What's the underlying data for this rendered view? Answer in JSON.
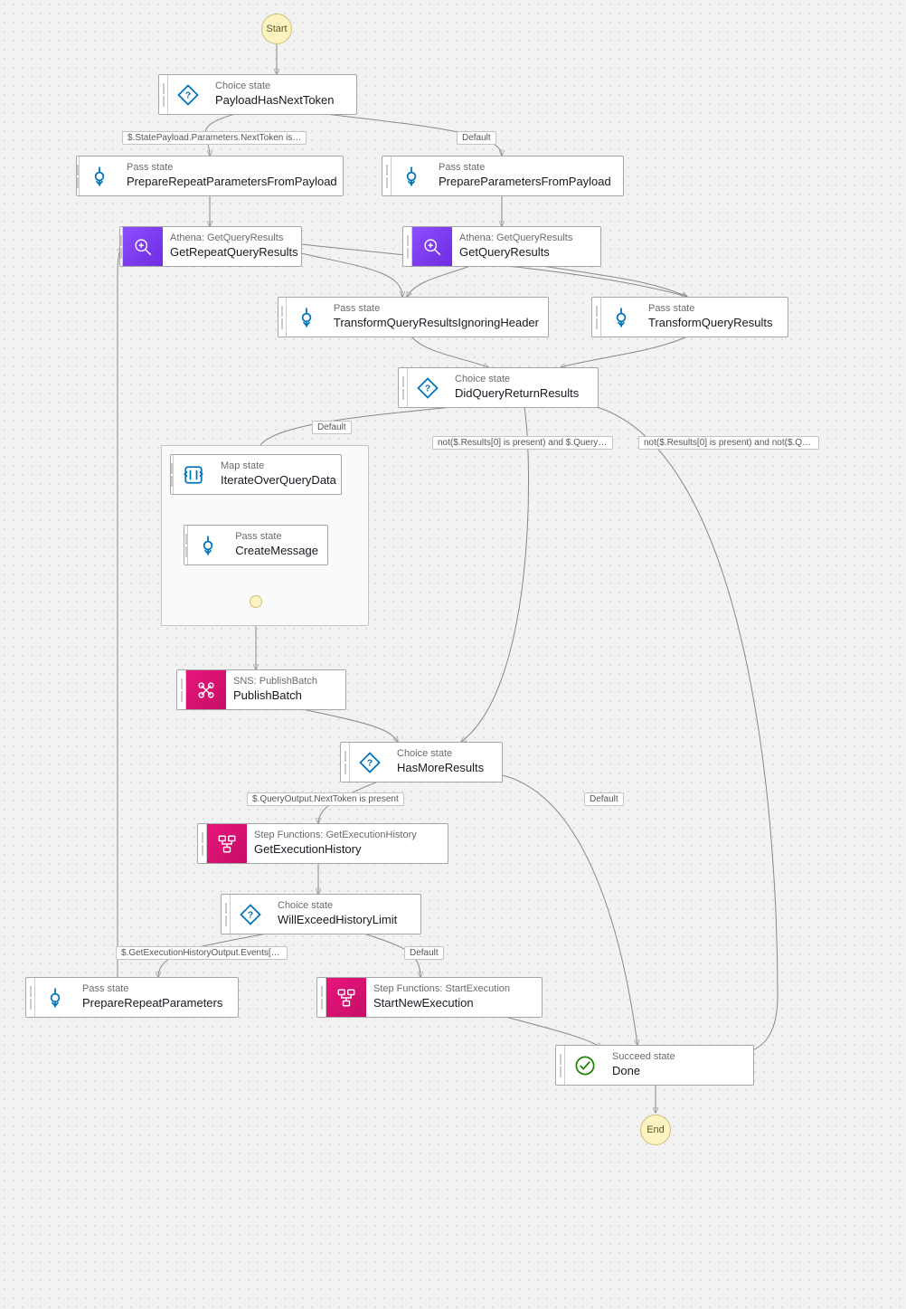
{
  "terminals": {
    "start": "Start",
    "end": "End"
  },
  "edge_labels": {
    "nextTokenPresent": "$.StatePayload.Parameters.NextToken is…",
    "default": "Default",
    "notPresentAndQO": "not($.Results[0] is present) and $.QueryO…",
    "notPresentAndNotQ": "not($.Results[0] is present) and not($.Qu…",
    "queryNextToken": "$.QueryOutput.NextToken is present",
    "historyEvents": "$.GetExecutionHistoryOutput.Events[0]…."
  },
  "nodes": {
    "payloadHasNextToken": {
      "type": "Choice state",
      "name": "PayloadHasNextToken"
    },
    "prepareRepeatFromPayload": {
      "type": "Pass state",
      "name": "PrepareRepeatParametersFromPayload"
    },
    "prepareFromPayload": {
      "type": "Pass state",
      "name": "PrepareParametersFromPayload"
    },
    "getRepeatQueryResults": {
      "type": "Athena: GetQueryResults",
      "name": "GetRepeatQueryResults"
    },
    "getQueryResults": {
      "type": "Athena: GetQueryResults",
      "name": "GetQueryResults"
    },
    "transformIgnoringHeader": {
      "type": "Pass state",
      "name": "TransformQueryResultsIgnoringHeader"
    },
    "transformQueryResults": {
      "type": "Pass state",
      "name": "TransformQueryResults"
    },
    "didQueryReturnResults": {
      "type": "Choice state",
      "name": "DidQueryReturnResults"
    },
    "iterateOverQueryData": {
      "type": "Map state",
      "name": "IterateOverQueryData"
    },
    "createMessage": {
      "type": "Pass state",
      "name": "CreateMessage"
    },
    "publishBatch": {
      "type": "SNS: PublishBatch",
      "name": "PublishBatch"
    },
    "hasMoreResults": {
      "type": "Choice state",
      "name": "HasMoreResults"
    },
    "getExecutionHistory": {
      "type": "Step Functions: GetExecutionHistory",
      "name": "GetExecutionHistory"
    },
    "willExceedHistoryLimit": {
      "type": "Choice state",
      "name": "WillExceedHistoryLimit"
    },
    "prepareRepeatParameters": {
      "type": "Pass state",
      "name": "PrepareRepeatParameters"
    },
    "startNewExecution": {
      "type": "Step Functions: StartExecution",
      "name": "StartNewExecution"
    },
    "done": {
      "type": "Succeed state",
      "name": "Done"
    }
  },
  "chart_data": {
    "type": "state-machine-graph",
    "title": "Step Functions workflow",
    "start": "PayloadHasNextToken",
    "states": [
      {
        "name": "PayloadHasNextToken",
        "kind": "Choice",
        "choices": [
          {
            "cond": "$.StatePayload.Parameters.NextToken is present",
            "next": "PrepareRepeatParametersFromPayload"
          }
        ],
        "default": "PrepareParametersFromPayload"
      },
      {
        "name": "PrepareRepeatParametersFromPayload",
        "kind": "Pass",
        "next": "GetRepeatQueryResults"
      },
      {
        "name": "PrepareParametersFromPayload",
        "kind": "Pass",
        "next": "GetQueryResults"
      },
      {
        "name": "GetRepeatQueryResults",
        "kind": "Task",
        "service": "Athena",
        "api": "GetQueryResults",
        "next": [
          "TransformQueryResultsIgnoringHeader",
          "TransformQueryResults"
        ]
      },
      {
        "name": "GetQueryResults",
        "kind": "Task",
        "service": "Athena",
        "api": "GetQueryResults",
        "next": [
          "TransformQueryResultsIgnoringHeader",
          "TransformQueryResults"
        ]
      },
      {
        "name": "TransformQueryResultsIgnoringHeader",
        "kind": "Pass",
        "next": "DidQueryReturnResults"
      },
      {
        "name": "TransformQueryResults",
        "kind": "Pass",
        "next": "DidQueryReturnResults"
      },
      {
        "name": "DidQueryReturnResults",
        "kind": "Choice",
        "choices": [
          {
            "cond": "not($.Results[0] is present) and $.QueryOutput…",
            "next": "HasMoreResults"
          },
          {
            "cond": "not($.Results[0] is present) and not($.QueryOutput…)",
            "next": "Done"
          }
        ],
        "default": "IterateOverQueryData"
      },
      {
        "name": "IterateOverQueryData",
        "kind": "Map",
        "iterator_start": "CreateMessage",
        "next": "PublishBatch"
      },
      {
        "name": "CreateMessage",
        "kind": "Pass",
        "next": null
      },
      {
        "name": "PublishBatch",
        "kind": "Task",
        "service": "SNS",
        "api": "PublishBatch",
        "next": "HasMoreResults"
      },
      {
        "name": "HasMoreResults",
        "kind": "Choice",
        "choices": [
          {
            "cond": "$.QueryOutput.NextToken is present",
            "next": "GetExecutionHistory"
          }
        ],
        "default": "Done"
      },
      {
        "name": "GetExecutionHistory",
        "kind": "Task",
        "service": "StepFunctions",
        "api": "GetExecutionHistory",
        "next": "WillExceedHistoryLimit"
      },
      {
        "name": "WillExceedHistoryLimit",
        "kind": "Choice",
        "choices": [
          {
            "cond": "$.GetExecutionHistoryOutput.Events[0]…",
            "next": "PrepareRepeatParameters"
          }
        ],
        "default": "StartNewExecution"
      },
      {
        "name": "PrepareRepeatParameters",
        "kind": "Pass",
        "next": "GetRepeatQueryResults"
      },
      {
        "name": "StartNewExecution",
        "kind": "Task",
        "service": "StepFunctions",
        "api": "StartExecution",
        "next": "Done"
      },
      {
        "name": "Done",
        "kind": "Succeed"
      }
    ]
  }
}
